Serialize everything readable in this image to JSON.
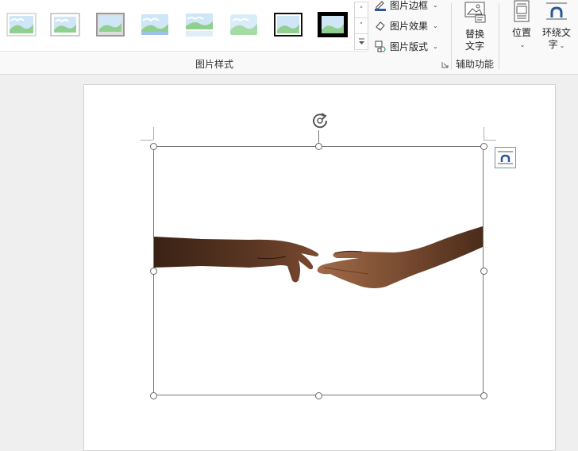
{
  "ribbon": {
    "gallery": {
      "group_label": "图片样式",
      "styles": [
        "style-simple-frame-white",
        "style-thin-border",
        "style-shadow-rectangle",
        "style-soft-edge",
        "style-reflected",
        "style-bevel-soft",
        "style-simple-frame-black",
        "style-thick-matte-black"
      ],
      "scroll_up": "˄",
      "scroll_down": "˅",
      "more": "more-icon"
    },
    "commands": {
      "border": "图片边框",
      "effects": "图片效果",
      "layout": "图片版式"
    },
    "accessibility": {
      "alt_text_line1": "替换",
      "alt_text_line2": "文字",
      "group_label": "辅助功能"
    },
    "arrange": {
      "position": "位置",
      "wrap_line1": "环绕文",
      "wrap_line2": "字"
    }
  },
  "document": {
    "image_description": "two-hands-reaching-photo"
  },
  "colors": {
    "accent": "#2b579a",
    "skin_dark": "#4a2b1a",
    "skin_mid": "#8a5a3c"
  }
}
